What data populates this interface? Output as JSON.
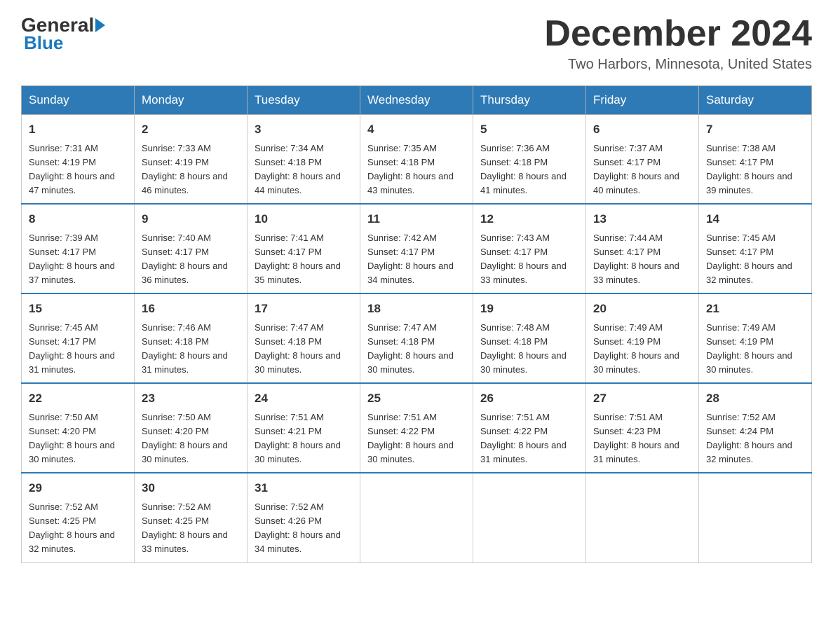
{
  "header": {
    "logo_general": "General",
    "logo_blue": "Blue",
    "month_title": "December 2024",
    "location": "Two Harbors, Minnesota, United States"
  },
  "days_of_week": [
    "Sunday",
    "Monday",
    "Tuesday",
    "Wednesday",
    "Thursday",
    "Friday",
    "Saturday"
  ],
  "weeks": [
    [
      {
        "day": "1",
        "sunrise": "7:31 AM",
        "sunset": "4:19 PM",
        "daylight": "8 hours and 47 minutes."
      },
      {
        "day": "2",
        "sunrise": "7:33 AM",
        "sunset": "4:19 PM",
        "daylight": "8 hours and 46 minutes."
      },
      {
        "day": "3",
        "sunrise": "7:34 AM",
        "sunset": "4:18 PM",
        "daylight": "8 hours and 44 minutes."
      },
      {
        "day": "4",
        "sunrise": "7:35 AM",
        "sunset": "4:18 PM",
        "daylight": "8 hours and 43 minutes."
      },
      {
        "day": "5",
        "sunrise": "7:36 AM",
        "sunset": "4:18 PM",
        "daylight": "8 hours and 41 minutes."
      },
      {
        "day": "6",
        "sunrise": "7:37 AM",
        "sunset": "4:17 PM",
        "daylight": "8 hours and 40 minutes."
      },
      {
        "day": "7",
        "sunrise": "7:38 AM",
        "sunset": "4:17 PM",
        "daylight": "8 hours and 39 minutes."
      }
    ],
    [
      {
        "day": "8",
        "sunrise": "7:39 AM",
        "sunset": "4:17 PM",
        "daylight": "8 hours and 37 minutes."
      },
      {
        "day": "9",
        "sunrise": "7:40 AM",
        "sunset": "4:17 PM",
        "daylight": "8 hours and 36 minutes."
      },
      {
        "day": "10",
        "sunrise": "7:41 AM",
        "sunset": "4:17 PM",
        "daylight": "8 hours and 35 minutes."
      },
      {
        "day": "11",
        "sunrise": "7:42 AM",
        "sunset": "4:17 PM",
        "daylight": "8 hours and 34 minutes."
      },
      {
        "day": "12",
        "sunrise": "7:43 AM",
        "sunset": "4:17 PM",
        "daylight": "8 hours and 33 minutes."
      },
      {
        "day": "13",
        "sunrise": "7:44 AM",
        "sunset": "4:17 PM",
        "daylight": "8 hours and 33 minutes."
      },
      {
        "day": "14",
        "sunrise": "7:45 AM",
        "sunset": "4:17 PM",
        "daylight": "8 hours and 32 minutes."
      }
    ],
    [
      {
        "day": "15",
        "sunrise": "7:45 AM",
        "sunset": "4:17 PM",
        "daylight": "8 hours and 31 minutes."
      },
      {
        "day": "16",
        "sunrise": "7:46 AM",
        "sunset": "4:18 PM",
        "daylight": "8 hours and 31 minutes."
      },
      {
        "day": "17",
        "sunrise": "7:47 AM",
        "sunset": "4:18 PM",
        "daylight": "8 hours and 30 minutes."
      },
      {
        "day": "18",
        "sunrise": "7:47 AM",
        "sunset": "4:18 PM",
        "daylight": "8 hours and 30 minutes."
      },
      {
        "day": "19",
        "sunrise": "7:48 AM",
        "sunset": "4:18 PM",
        "daylight": "8 hours and 30 minutes."
      },
      {
        "day": "20",
        "sunrise": "7:49 AM",
        "sunset": "4:19 PM",
        "daylight": "8 hours and 30 minutes."
      },
      {
        "day": "21",
        "sunrise": "7:49 AM",
        "sunset": "4:19 PM",
        "daylight": "8 hours and 30 minutes."
      }
    ],
    [
      {
        "day": "22",
        "sunrise": "7:50 AM",
        "sunset": "4:20 PM",
        "daylight": "8 hours and 30 minutes."
      },
      {
        "day": "23",
        "sunrise": "7:50 AM",
        "sunset": "4:20 PM",
        "daylight": "8 hours and 30 minutes."
      },
      {
        "day": "24",
        "sunrise": "7:51 AM",
        "sunset": "4:21 PM",
        "daylight": "8 hours and 30 minutes."
      },
      {
        "day": "25",
        "sunrise": "7:51 AM",
        "sunset": "4:22 PM",
        "daylight": "8 hours and 30 minutes."
      },
      {
        "day": "26",
        "sunrise": "7:51 AM",
        "sunset": "4:22 PM",
        "daylight": "8 hours and 31 minutes."
      },
      {
        "day": "27",
        "sunrise": "7:51 AM",
        "sunset": "4:23 PM",
        "daylight": "8 hours and 31 minutes."
      },
      {
        "day": "28",
        "sunrise": "7:52 AM",
        "sunset": "4:24 PM",
        "daylight": "8 hours and 32 minutes."
      }
    ],
    [
      {
        "day": "29",
        "sunrise": "7:52 AM",
        "sunset": "4:25 PM",
        "daylight": "8 hours and 32 minutes."
      },
      {
        "day": "30",
        "sunrise": "7:52 AM",
        "sunset": "4:25 PM",
        "daylight": "8 hours and 33 minutes."
      },
      {
        "day": "31",
        "sunrise": "7:52 AM",
        "sunset": "4:26 PM",
        "daylight": "8 hours and 34 minutes."
      },
      null,
      null,
      null,
      null
    ]
  ]
}
